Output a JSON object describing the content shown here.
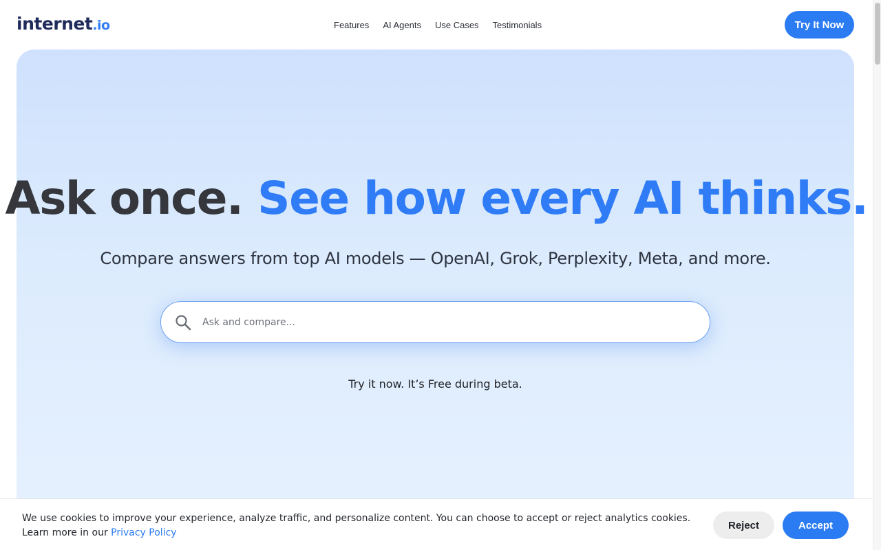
{
  "brand": {
    "name_main": "internet",
    "name_tld": ".io",
    "colors": {
      "navy": "#1e2a5a",
      "accent": "#2f7cf6",
      "button": "#2b7bf2"
    }
  },
  "nav": {
    "items": [
      {
        "label": "Features"
      },
      {
        "label": "AI Agents"
      },
      {
        "label": "Use Cases"
      },
      {
        "label": "Testimonials"
      }
    ],
    "cta_label": "Try It Now"
  },
  "hero": {
    "headline_part1": "Ask once.",
    "headline_part2": "See how every AI thinks.",
    "subhead": "Compare answers from top AI models — OpenAI, Grok, Perplexity, Meta, and more.",
    "search": {
      "placeholder": "Ask and compare...",
      "value": "",
      "icon": "search-icon"
    },
    "tagline": "Try it now. It’s Free during beta."
  },
  "cookie_banner": {
    "text": "We use cookies to improve your experience, analyze traffic, and personalize content. You can choose to accept or reject analytics cookies. Learn more in our",
    "link_label": "Privacy Policy",
    "reject_label": "Reject",
    "accept_label": "Accept"
  }
}
